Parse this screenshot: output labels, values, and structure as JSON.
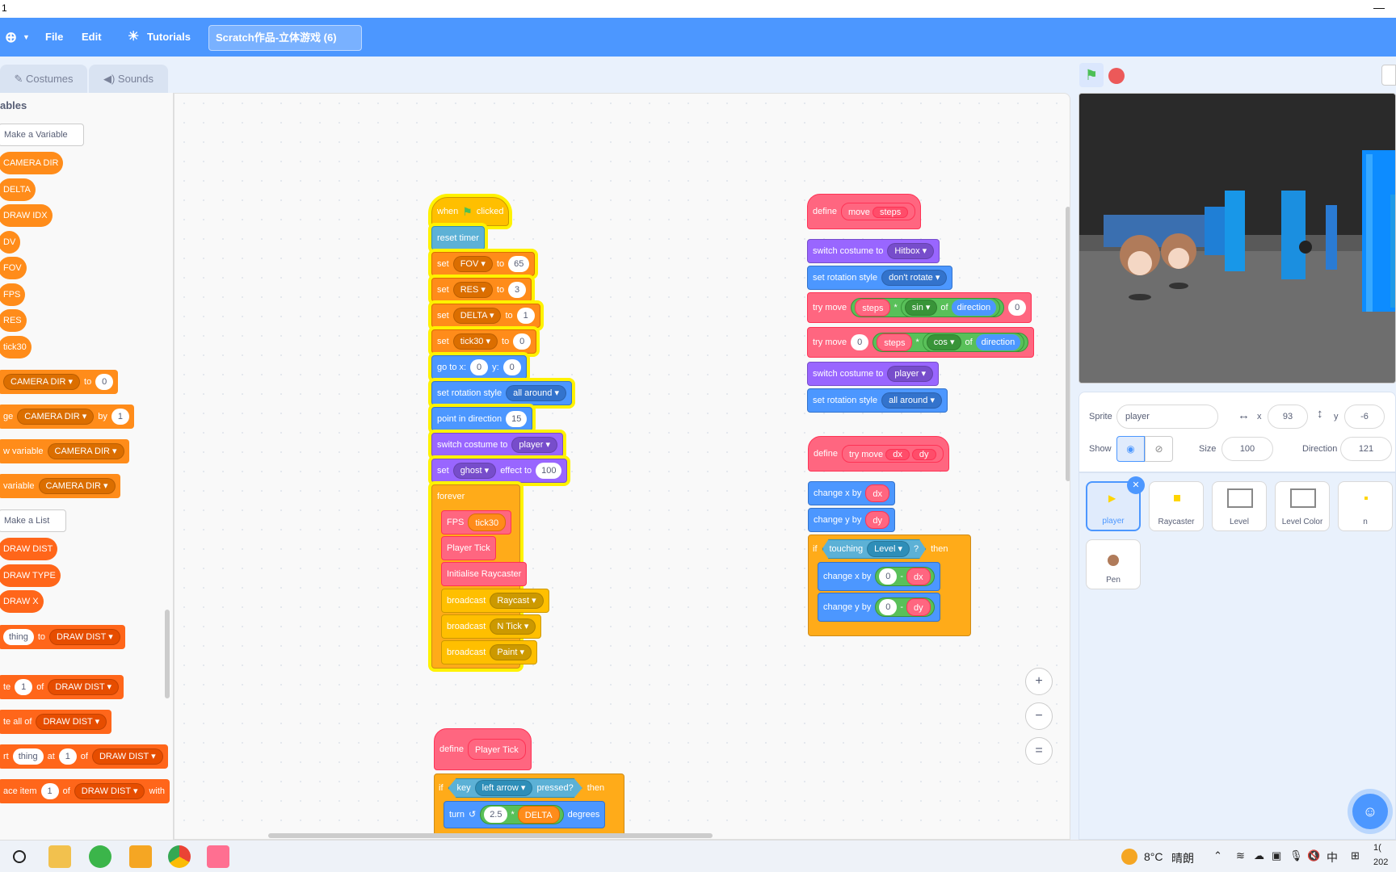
{
  "window": {
    "title_char": "1",
    "minimize": "—"
  },
  "menu": {
    "globe": "⊕",
    "file": "File",
    "edit": "Edit",
    "tutorials": "Tutorials",
    "project_title": "Scratch作品-立体游戏 (6)"
  },
  "tabs": {
    "costumes": "Costumes",
    "sounds": "Sounds"
  },
  "palette": {
    "section": "ables",
    "make_variable": "Make a Variable",
    "variables": [
      "CAMERA DIR",
      "DELTA",
      "DRAW IDX",
      "DV",
      "FOV",
      "FPS",
      "RES",
      "tick30"
    ],
    "set_var": {
      "label": "CAMERA DIR",
      "to": "to",
      "val": "0"
    },
    "change_var": {
      "prefix": "ge",
      "label": "CAMERA DIR",
      "by": "by",
      "val": "1"
    },
    "show_var": {
      "prefix": "w variable",
      "label": "CAMERA DIR"
    },
    "hide_var": {
      "prefix": "variable",
      "label": "CAMERA DIR"
    },
    "make_list": "Make a List",
    "lists": [
      "DRAW DIST",
      "DRAW TYPE",
      "DRAW X"
    ],
    "add_item": {
      "val": "thing",
      "to": "to",
      "list": "DRAW DIST"
    },
    "delete_item": {
      "prefix": "te",
      "val": "1",
      "of": "of",
      "list": "DRAW DIST"
    },
    "delete_all": {
      "prefix": "te all of",
      "list": "DRAW DIST"
    },
    "insert_item": {
      "prefix": "rt",
      "val": "thing",
      "at": "at",
      "idx": "1",
      "of": "of",
      "list": "DRAW DIST"
    },
    "replace_item": {
      "prefix": "ace item",
      "idx": "1",
      "of": "of",
      "list": "DRAW DIST",
      "with": "with"
    }
  },
  "script1": {
    "when": "when",
    "clicked": "clicked",
    "flag": "⚑",
    "reset_timer": "reset timer",
    "set": "set",
    "to": "to",
    "fov": "FOV",
    "fov_val": "65",
    "res": "RES",
    "res_val": "3",
    "delta": "DELTA",
    "delta_val": "1",
    "tick30": "tick30",
    "tick30_val": "0",
    "goto": "go to x:",
    "x": "0",
    "y_label": "y:",
    "y": "0",
    "rot_style": "set rotation style",
    "rot_val": "all around",
    "point_dir": "point in direction",
    "dir_val": "15",
    "switch_costume": "switch costume to",
    "costume": "player",
    "ghost": "ghost",
    "effect_to": "effect to",
    "ghost_val": "100",
    "forever": "forever",
    "fps": "FPS",
    "fps_arg": "tick30",
    "player_tick": "Player Tick",
    "init_raycaster": "Initialise Raycaster",
    "broadcast": "broadcast",
    "msg1": "Raycast",
    "msg2": "N Tick",
    "msg3": "Paint",
    "loop_arrow": "↺"
  },
  "script2": {
    "define": "define",
    "move": "move",
    "steps": "steps",
    "switch_costume": "switch costume to",
    "hitbox": "Hitbox",
    "rot_style": "set rotation style",
    "dont_rotate": "don't rotate",
    "try_move": "try move",
    "times": "*",
    "sin": "sin",
    "of": "of",
    "direction": "direction",
    "zero": "0",
    "cos": "cos",
    "player": "player",
    "all_around": "all around"
  },
  "script3": {
    "define": "define",
    "try_move": "try move",
    "dx": "dx",
    "dy": "dy",
    "change_x": "change x by",
    "change_y": "change y by",
    "if": "if",
    "touching": "touching",
    "level": "Level",
    "q": "?",
    "then": "then",
    "zero": "0",
    "minus": "-"
  },
  "script4": {
    "define": "define",
    "player_tick": "Player Tick",
    "if": "if",
    "key": "key",
    "left_arrow": "left arrow",
    "pressed": "pressed?",
    "then": "then",
    "turn": "turn",
    "turn_icon": "↺",
    "val": "2.5",
    "times": "*",
    "delta": "DELTA",
    "degrees": "degrees"
  },
  "zoom": {
    "in": "+",
    "out": "−",
    "reset": "="
  },
  "stage_controls": {
    "go": "⚑",
    "stop": "⬣"
  },
  "sprite_info": {
    "sprite_label": "Sprite",
    "sprite_name": "player",
    "x_label": "x",
    "x_val": "93",
    "y_label": "y",
    "y_val": "-6",
    "show_label": "Show",
    "size_label": "Size",
    "size_val": "100",
    "direction_label": "Direction",
    "direction_val": "121"
  },
  "sprites": [
    "player",
    "Raycaster",
    "Level",
    "Level Color",
    "n",
    "Pen"
  ],
  "taskbar": {
    "weather": "8°C",
    "weather_desc": "晴朗",
    "ime": "中",
    "clock_time": "1(",
    "clock_date": "202"
  },
  "colors": {
    "scratch_blue": "#4c97ff",
    "variables": "#ff8c1a",
    "lists": "#ff661a",
    "events": "#ffbf00",
    "control": "#ffab19",
    "motion": "#4c97ff",
    "looks": "#9966ff",
    "custom": "#ff6680",
    "sensing": "#5cb1d6",
    "operators": "#59c059"
  }
}
